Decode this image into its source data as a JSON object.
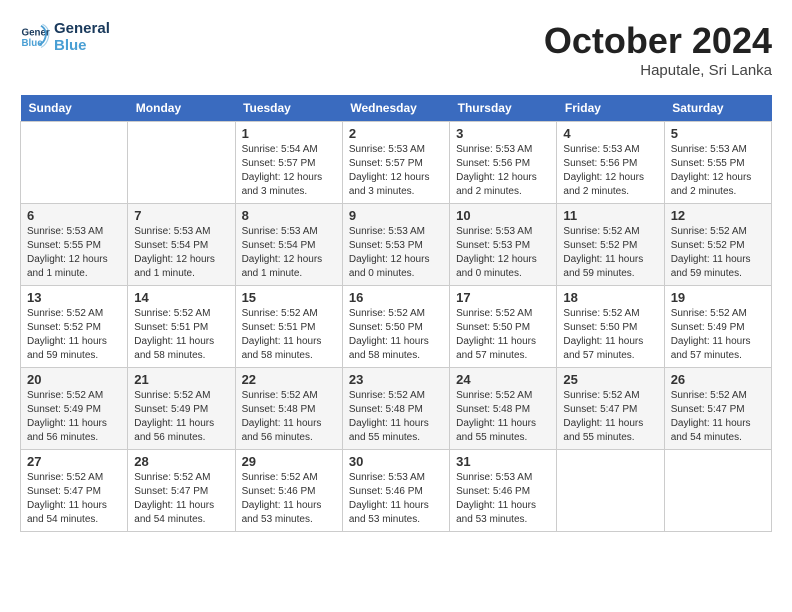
{
  "logo": {
    "line1": "General",
    "line2": "Blue"
  },
  "title": "October 2024",
  "subtitle": "Haputale, Sri Lanka",
  "days_header": [
    "Sunday",
    "Monday",
    "Tuesday",
    "Wednesday",
    "Thursday",
    "Friday",
    "Saturday"
  ],
  "weeks": [
    [
      {
        "day": "",
        "detail": ""
      },
      {
        "day": "",
        "detail": ""
      },
      {
        "day": "1",
        "detail": "Sunrise: 5:54 AM\nSunset: 5:57 PM\nDaylight: 12 hours\nand 3 minutes."
      },
      {
        "day": "2",
        "detail": "Sunrise: 5:53 AM\nSunset: 5:57 PM\nDaylight: 12 hours\nand 3 minutes."
      },
      {
        "day": "3",
        "detail": "Sunrise: 5:53 AM\nSunset: 5:56 PM\nDaylight: 12 hours\nand 2 minutes."
      },
      {
        "day": "4",
        "detail": "Sunrise: 5:53 AM\nSunset: 5:56 PM\nDaylight: 12 hours\nand 2 minutes."
      },
      {
        "day": "5",
        "detail": "Sunrise: 5:53 AM\nSunset: 5:55 PM\nDaylight: 12 hours\nand 2 minutes."
      }
    ],
    [
      {
        "day": "6",
        "detail": "Sunrise: 5:53 AM\nSunset: 5:55 PM\nDaylight: 12 hours\nand 1 minute."
      },
      {
        "day": "7",
        "detail": "Sunrise: 5:53 AM\nSunset: 5:54 PM\nDaylight: 12 hours\nand 1 minute."
      },
      {
        "day": "8",
        "detail": "Sunrise: 5:53 AM\nSunset: 5:54 PM\nDaylight: 12 hours\nand 1 minute."
      },
      {
        "day": "9",
        "detail": "Sunrise: 5:53 AM\nSunset: 5:53 PM\nDaylight: 12 hours\nand 0 minutes."
      },
      {
        "day": "10",
        "detail": "Sunrise: 5:53 AM\nSunset: 5:53 PM\nDaylight: 12 hours\nand 0 minutes."
      },
      {
        "day": "11",
        "detail": "Sunrise: 5:52 AM\nSunset: 5:52 PM\nDaylight: 11 hours\nand 59 minutes."
      },
      {
        "day": "12",
        "detail": "Sunrise: 5:52 AM\nSunset: 5:52 PM\nDaylight: 11 hours\nand 59 minutes."
      }
    ],
    [
      {
        "day": "13",
        "detail": "Sunrise: 5:52 AM\nSunset: 5:52 PM\nDaylight: 11 hours\nand 59 minutes."
      },
      {
        "day": "14",
        "detail": "Sunrise: 5:52 AM\nSunset: 5:51 PM\nDaylight: 11 hours\nand 58 minutes."
      },
      {
        "day": "15",
        "detail": "Sunrise: 5:52 AM\nSunset: 5:51 PM\nDaylight: 11 hours\nand 58 minutes."
      },
      {
        "day": "16",
        "detail": "Sunrise: 5:52 AM\nSunset: 5:50 PM\nDaylight: 11 hours\nand 58 minutes."
      },
      {
        "day": "17",
        "detail": "Sunrise: 5:52 AM\nSunset: 5:50 PM\nDaylight: 11 hours\nand 57 minutes."
      },
      {
        "day": "18",
        "detail": "Sunrise: 5:52 AM\nSunset: 5:50 PM\nDaylight: 11 hours\nand 57 minutes."
      },
      {
        "day": "19",
        "detail": "Sunrise: 5:52 AM\nSunset: 5:49 PM\nDaylight: 11 hours\nand 57 minutes."
      }
    ],
    [
      {
        "day": "20",
        "detail": "Sunrise: 5:52 AM\nSunset: 5:49 PM\nDaylight: 11 hours\nand 56 minutes."
      },
      {
        "day": "21",
        "detail": "Sunrise: 5:52 AM\nSunset: 5:49 PM\nDaylight: 11 hours\nand 56 minutes."
      },
      {
        "day": "22",
        "detail": "Sunrise: 5:52 AM\nSunset: 5:48 PM\nDaylight: 11 hours\nand 56 minutes."
      },
      {
        "day": "23",
        "detail": "Sunrise: 5:52 AM\nSunset: 5:48 PM\nDaylight: 11 hours\nand 55 minutes."
      },
      {
        "day": "24",
        "detail": "Sunrise: 5:52 AM\nSunset: 5:48 PM\nDaylight: 11 hours\nand 55 minutes."
      },
      {
        "day": "25",
        "detail": "Sunrise: 5:52 AM\nSunset: 5:47 PM\nDaylight: 11 hours\nand 55 minutes."
      },
      {
        "day": "26",
        "detail": "Sunrise: 5:52 AM\nSunset: 5:47 PM\nDaylight: 11 hours\nand 54 minutes."
      }
    ],
    [
      {
        "day": "27",
        "detail": "Sunrise: 5:52 AM\nSunset: 5:47 PM\nDaylight: 11 hours\nand 54 minutes."
      },
      {
        "day": "28",
        "detail": "Sunrise: 5:52 AM\nSunset: 5:47 PM\nDaylight: 11 hours\nand 54 minutes."
      },
      {
        "day": "29",
        "detail": "Sunrise: 5:52 AM\nSunset: 5:46 PM\nDaylight: 11 hours\nand 53 minutes."
      },
      {
        "day": "30",
        "detail": "Sunrise: 5:53 AM\nSunset: 5:46 PM\nDaylight: 11 hours\nand 53 minutes."
      },
      {
        "day": "31",
        "detail": "Sunrise: 5:53 AM\nSunset: 5:46 PM\nDaylight: 11 hours\nand 53 minutes."
      },
      {
        "day": "",
        "detail": ""
      },
      {
        "day": "",
        "detail": ""
      }
    ]
  ]
}
